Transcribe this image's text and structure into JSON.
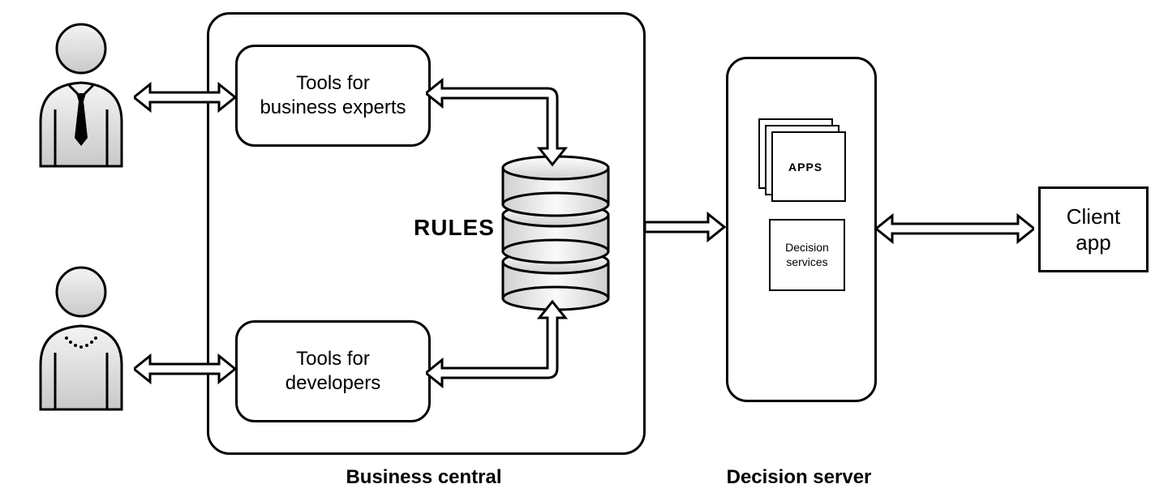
{
  "business_central": {
    "title": "Business central",
    "tool_experts": "Tools for\nbusiness experts",
    "tool_devs": "Tools for\ndevelopers",
    "rules_label": "RULES"
  },
  "decision_server": {
    "title": "Decision server",
    "apps_label": "APPS",
    "decision_services_label": "Decision\nservices"
  },
  "client_app": {
    "label": "Client\napp"
  }
}
